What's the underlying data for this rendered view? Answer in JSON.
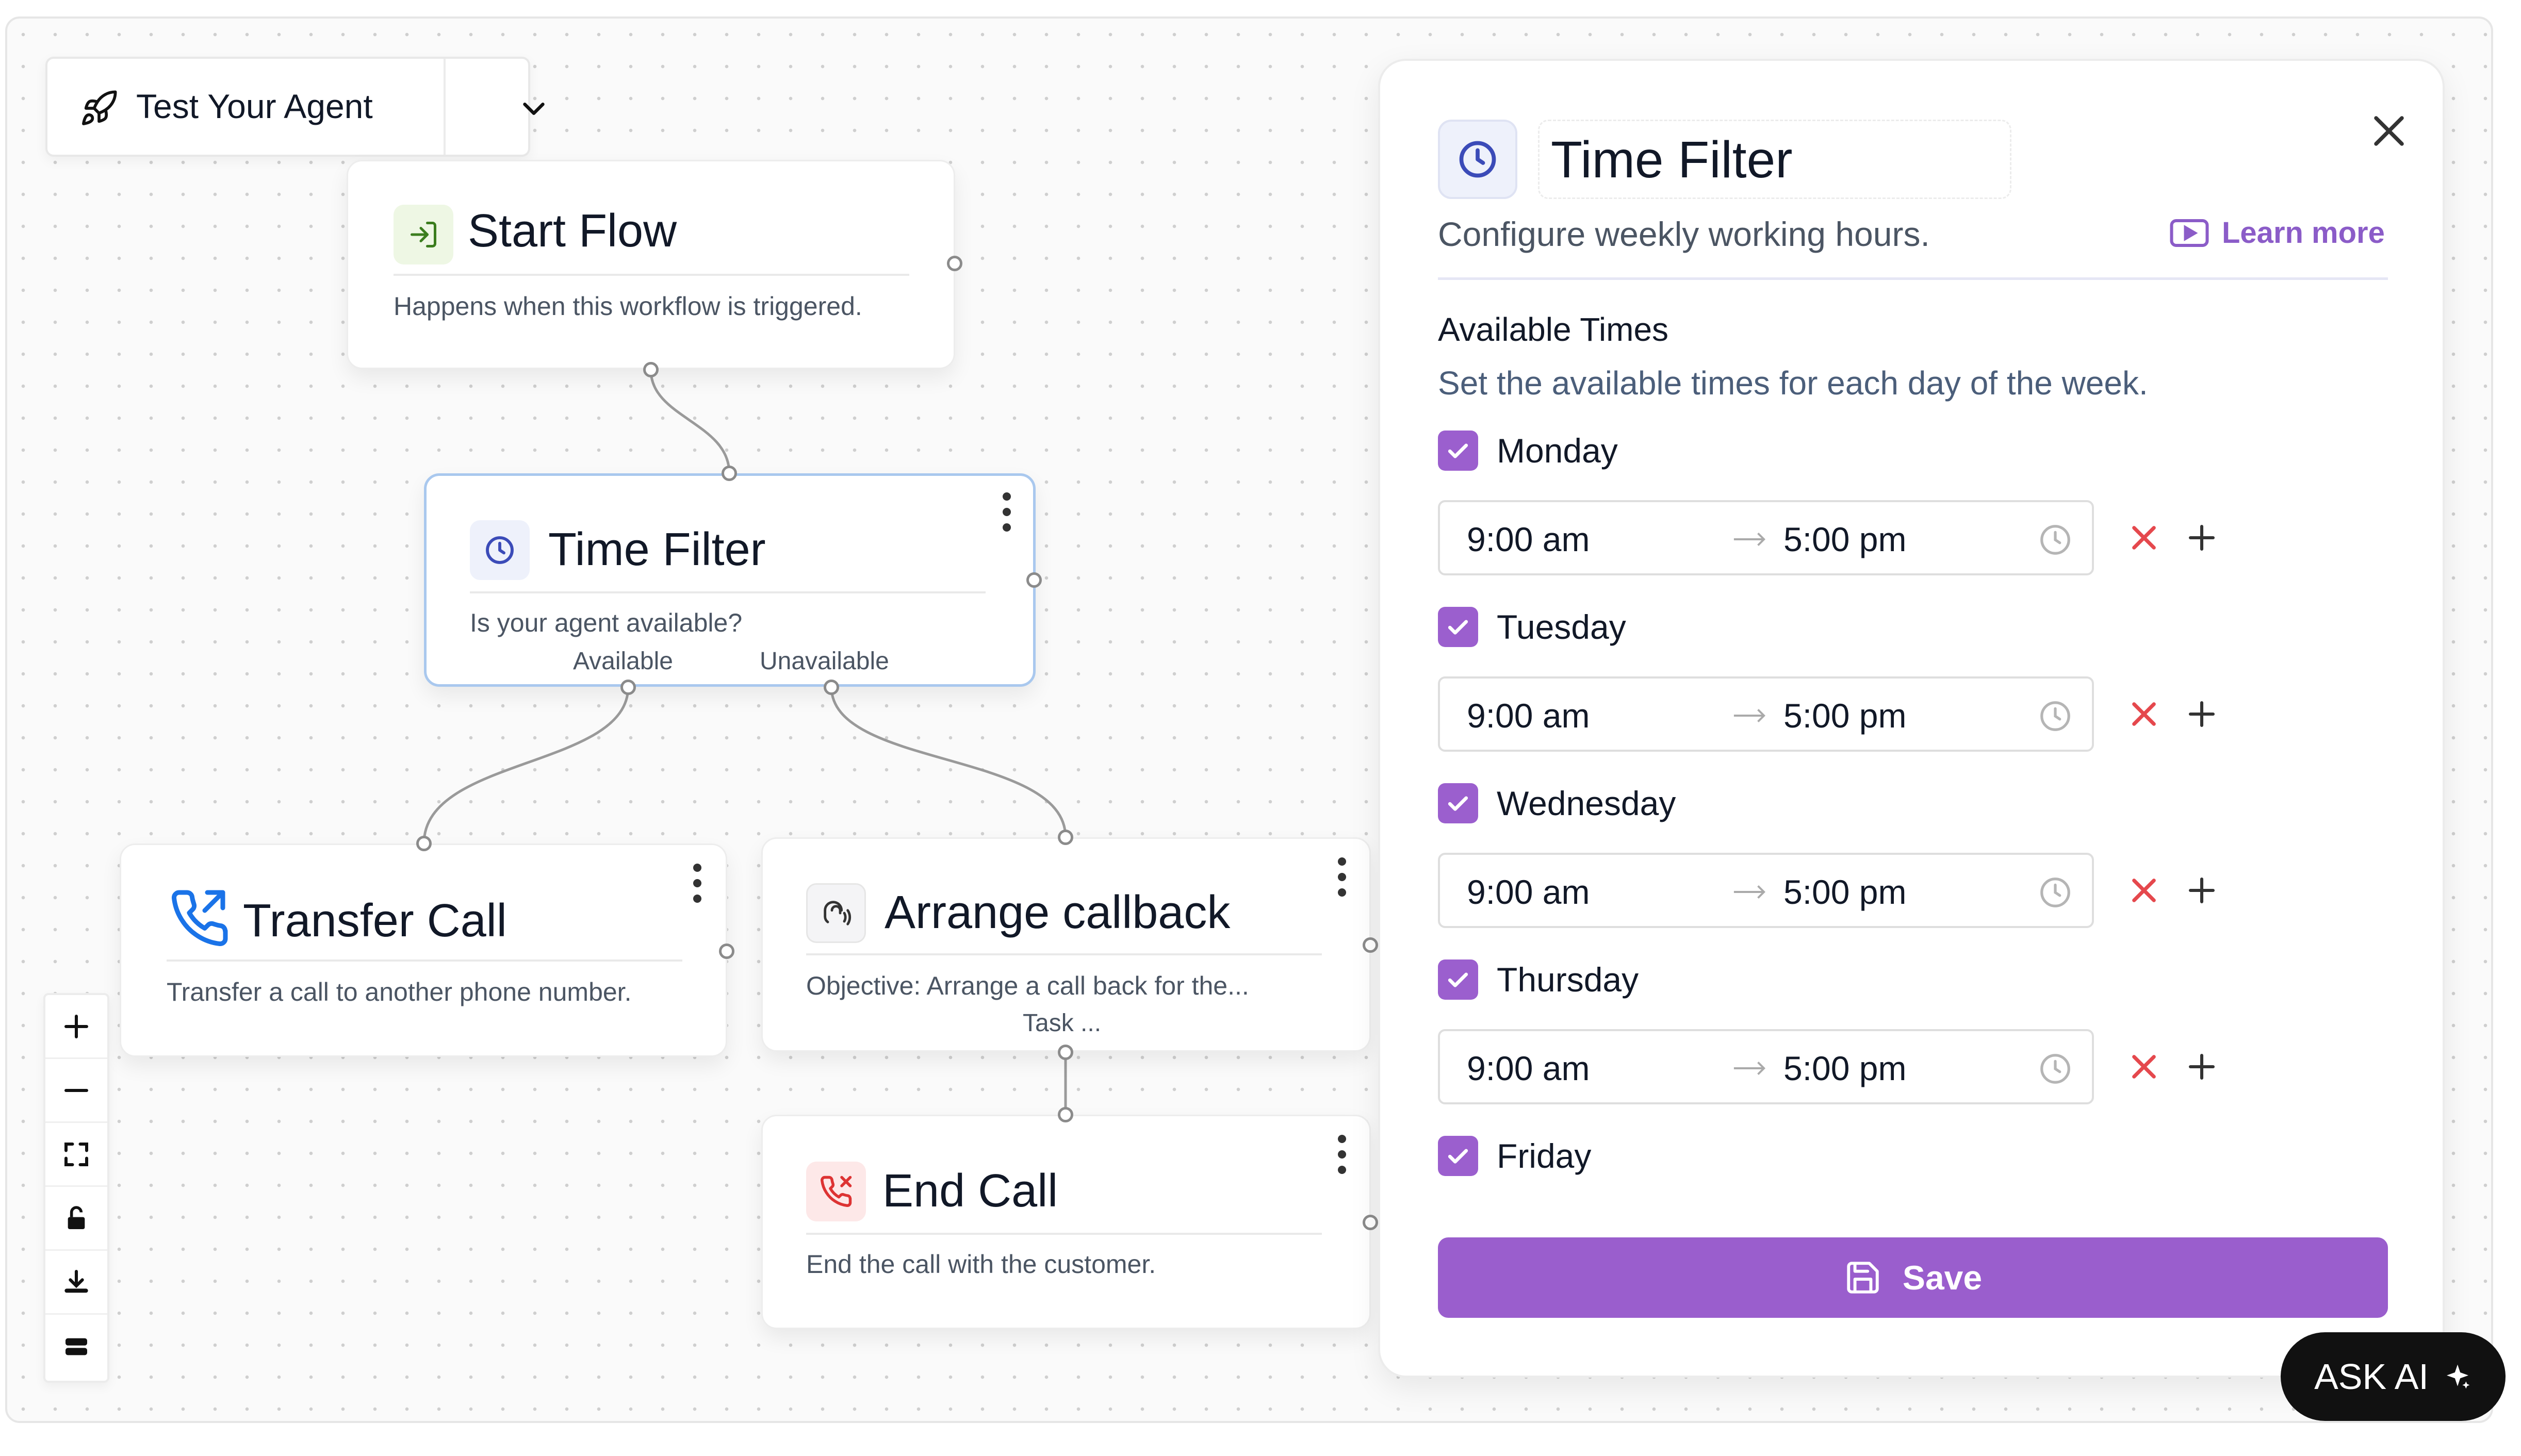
{
  "toolbar": {
    "test_agent_label": "Test Your Agent"
  },
  "nodes": {
    "start_flow": {
      "title": "Start Flow",
      "description": "Happens when this workflow is triggered."
    },
    "time_filter": {
      "title": "Time Filter",
      "description": "Is your agent available?",
      "branch_available": "Available",
      "branch_unavailable": "Unavailable"
    },
    "transfer_call": {
      "title": "Transfer Call",
      "description": "Transfer a call to another phone number."
    },
    "arrange_callback": {
      "title": "Arrange callback",
      "description": "Objective: Arrange a call back for the...",
      "task_label": "Task ..."
    },
    "end_call": {
      "title": "End Call",
      "description": "End the call with the customer."
    }
  },
  "panel": {
    "title": "Time Filter",
    "subtitle": "Configure weekly working hours.",
    "learn_more": "Learn more",
    "section_title": "Available Times",
    "section_description": "Set the available times for each day of the week.",
    "days": [
      {
        "label": "Monday",
        "checked": true,
        "start": "9:00 am",
        "end": "5:00 pm"
      },
      {
        "label": "Tuesday",
        "checked": true,
        "start": "9:00 am",
        "end": "5:00 pm"
      },
      {
        "label": "Wednesday",
        "checked": true,
        "start": "9:00 am",
        "end": "5:00 pm"
      },
      {
        "label": "Thursday",
        "checked": true,
        "start": "9:00 am",
        "end": "5:00 pm"
      },
      {
        "label": "Friday",
        "checked": true
      }
    ],
    "save_label": "Save"
  },
  "ask_ai": {
    "label": "ASK AI"
  },
  "icons": {
    "rocket": "rocket-icon",
    "chevron": "chevron-down-icon",
    "clock": "clock-icon",
    "close": "close-icon",
    "video": "play-video-icon",
    "phone_transfer": "phone-transfer-icon",
    "callback": "callback-icon",
    "end_call": "end-call-icon",
    "sparkle": "sparkle-icon"
  },
  "colors": {
    "accent": "#9a5ecd",
    "link": "#8b5cc8",
    "remove": "#e5484d",
    "selected_border": "#a9c8ee",
    "start_icon_bg": "#eef7e4",
    "end_icon_bg": "#fde8e8"
  }
}
